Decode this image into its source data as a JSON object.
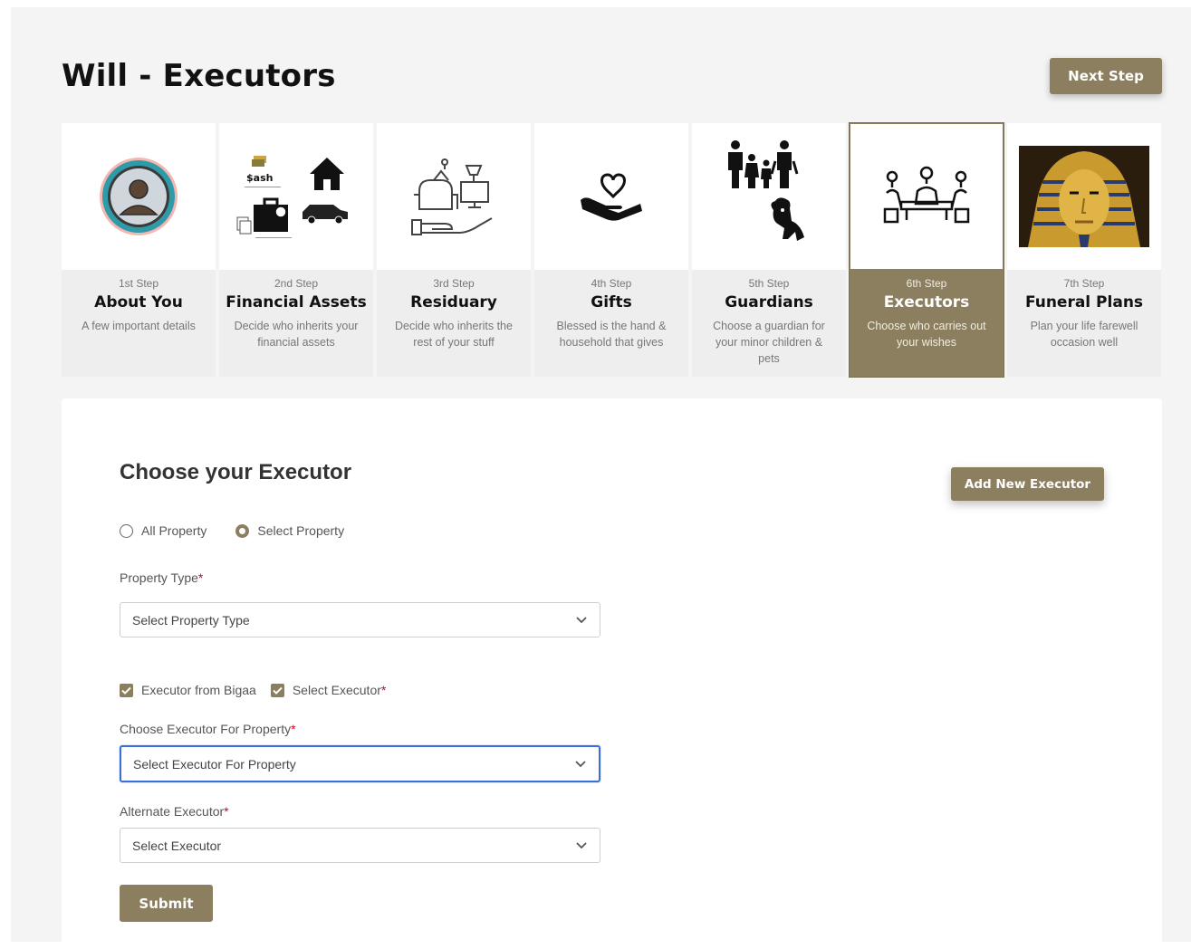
{
  "header": {
    "title": "Will - Executors",
    "next_label": "Next Step"
  },
  "steps": [
    {
      "num": "1st Step",
      "name": "About You",
      "desc": "A few important details",
      "icon": "user-avatar-icon",
      "active": false
    },
    {
      "num": "2nd Step",
      "name": "Financial Assets",
      "desc": "Decide who inherits your financial assets",
      "icon": "financial-assets-icon",
      "logo_text": "$ash",
      "active": false
    },
    {
      "num": "3rd Step",
      "name": "Residuary",
      "desc": "Decide who inherits the rest of your stuff",
      "icon": "furniture-hand-icon",
      "active": false
    },
    {
      "num": "4th Step",
      "name": "Gifts",
      "desc": "Blessed is the hand & household that gives",
      "icon": "heart-hand-icon",
      "active": false
    },
    {
      "num": "5th Step",
      "name": "Guardians",
      "desc": "Choose a guardian for your minor children & pets",
      "icon": "family-pet-icon",
      "active": false
    },
    {
      "num": "6th Step",
      "name": "Executors",
      "desc": "Choose who carries out your wishes",
      "icon": "executors-meeting-icon",
      "active": true
    },
    {
      "num": "7th Step",
      "name": "Funeral Plans",
      "desc": "Plan your life farewell occasion well",
      "icon": "pharaoh-mask-image",
      "active": false
    }
  ],
  "form": {
    "title": "Choose your Executor",
    "add_label": "Add New Executor",
    "radios": [
      {
        "label": "All Property",
        "checked": false
      },
      {
        "label": "Select Property",
        "checked": true
      }
    ],
    "property_type_label": "Property Type",
    "property_type_value": "Select Property Type",
    "checkboxes": [
      {
        "label": "Executor from Bigaa",
        "checked": true,
        "required": false
      },
      {
        "label": "Select Executor",
        "checked": true,
        "required": true
      }
    ],
    "executor_label": "Choose Executor For Property",
    "executor_value": "Select Executor For Property",
    "alternate_label": "Alternate Executor",
    "alternate_value": "Select Executor",
    "required_mark": "*",
    "submit_label": "Submit"
  },
  "colors": {
    "accent": "#8c7f60",
    "focus": "#3b6fd8",
    "required": "#d0021b",
    "background": "#f4f4f4"
  }
}
